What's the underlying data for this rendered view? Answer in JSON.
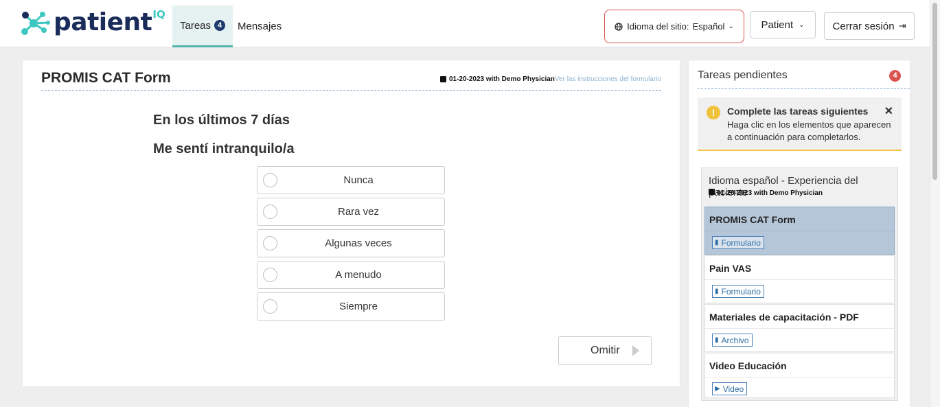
{
  "brand": {
    "name": "patient",
    "suffix": "IQ"
  },
  "nav": {
    "tabs": [
      {
        "label": "Tareas",
        "badge": "4"
      },
      {
        "label": "Mensajes"
      }
    ],
    "language": {
      "label": "Idioma del sitio:",
      "value": "Español"
    },
    "user_menu": "Patient",
    "logout": "Cerrar sesión"
  },
  "form": {
    "title": "PROMIS CAT Form",
    "date": "01-20-2023 with Demo Physician",
    "instructions_link": "Ver las instrucciones del formulario",
    "question_period": "En los últimos 7 días",
    "question": "Me sentí intranquilo/a",
    "options": [
      "Nunca",
      "Rara vez",
      "Algunas veces",
      "A menudo",
      "Siempre"
    ],
    "skip_label": "Omitir"
  },
  "sidebar": {
    "title": "Tareas pendientes",
    "badge": "4",
    "alert": {
      "title": "Complete las tareas siguientes",
      "body": "Haga clic en los elementos que aparecen a continuación para completarlos."
    },
    "group": {
      "title": "Idioma español - Experiencia del paciente",
      "date": "01-20-2023 with Demo Physician",
      "tasks": [
        {
          "name": "PROMIS CAT Form",
          "tag": "Formulario",
          "icon": "file-icon"
        },
        {
          "name": "Pain VAS",
          "tag": "Formulario",
          "icon": "file-icon"
        },
        {
          "name": "Materiales de capacitación - PDF",
          "tag": "Archivo",
          "icon": "file-icon"
        },
        {
          "name": "Video Educación",
          "tag": "Video",
          "icon": "video-icon"
        }
      ]
    }
  },
  "colors": {
    "brand_navy": "#1a2d5a",
    "brand_teal": "#3ec7c0",
    "active_tab_bg": "#e6f2f1",
    "alert_border": "#f0c23b",
    "badge_red": "#d9534f",
    "selected_task_bg": "#b6c6d9"
  }
}
